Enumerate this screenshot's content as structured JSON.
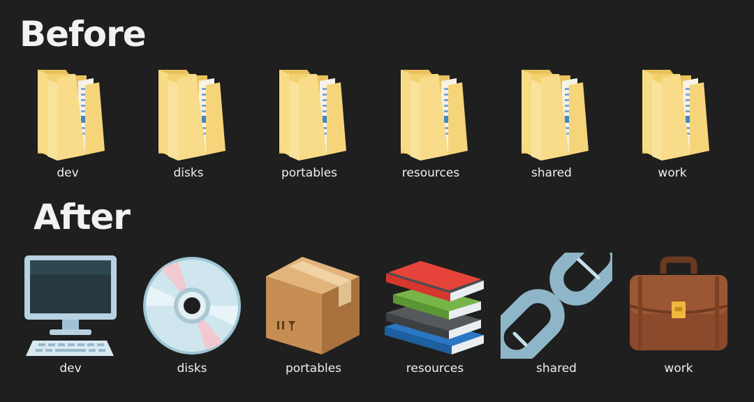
{
  "sections": {
    "before": {
      "title": "Before",
      "items": [
        {
          "label": "dev",
          "icon": "folder-icon"
        },
        {
          "label": "disks",
          "icon": "folder-icon"
        },
        {
          "label": "portables",
          "icon": "folder-icon"
        },
        {
          "label": "resources",
          "icon": "folder-icon"
        },
        {
          "label": "shared",
          "icon": "folder-icon"
        },
        {
          "label": "work",
          "icon": "folder-icon"
        }
      ]
    },
    "after": {
      "title": "After",
      "items": [
        {
          "label": "dev",
          "icon": "desktop-computer-icon"
        },
        {
          "label": "disks",
          "icon": "optical-disc-icon"
        },
        {
          "label": "portables",
          "icon": "cardboard-box-icon"
        },
        {
          "label": "resources",
          "icon": "books-icon"
        },
        {
          "label": "shared",
          "icon": "chain-link-icon"
        },
        {
          "label": "work",
          "icon": "briefcase-icon"
        }
      ]
    }
  },
  "colors": {
    "background": "#1f1f1f",
    "folder": "#f5d77f",
    "text": "#f0f0f0"
  }
}
